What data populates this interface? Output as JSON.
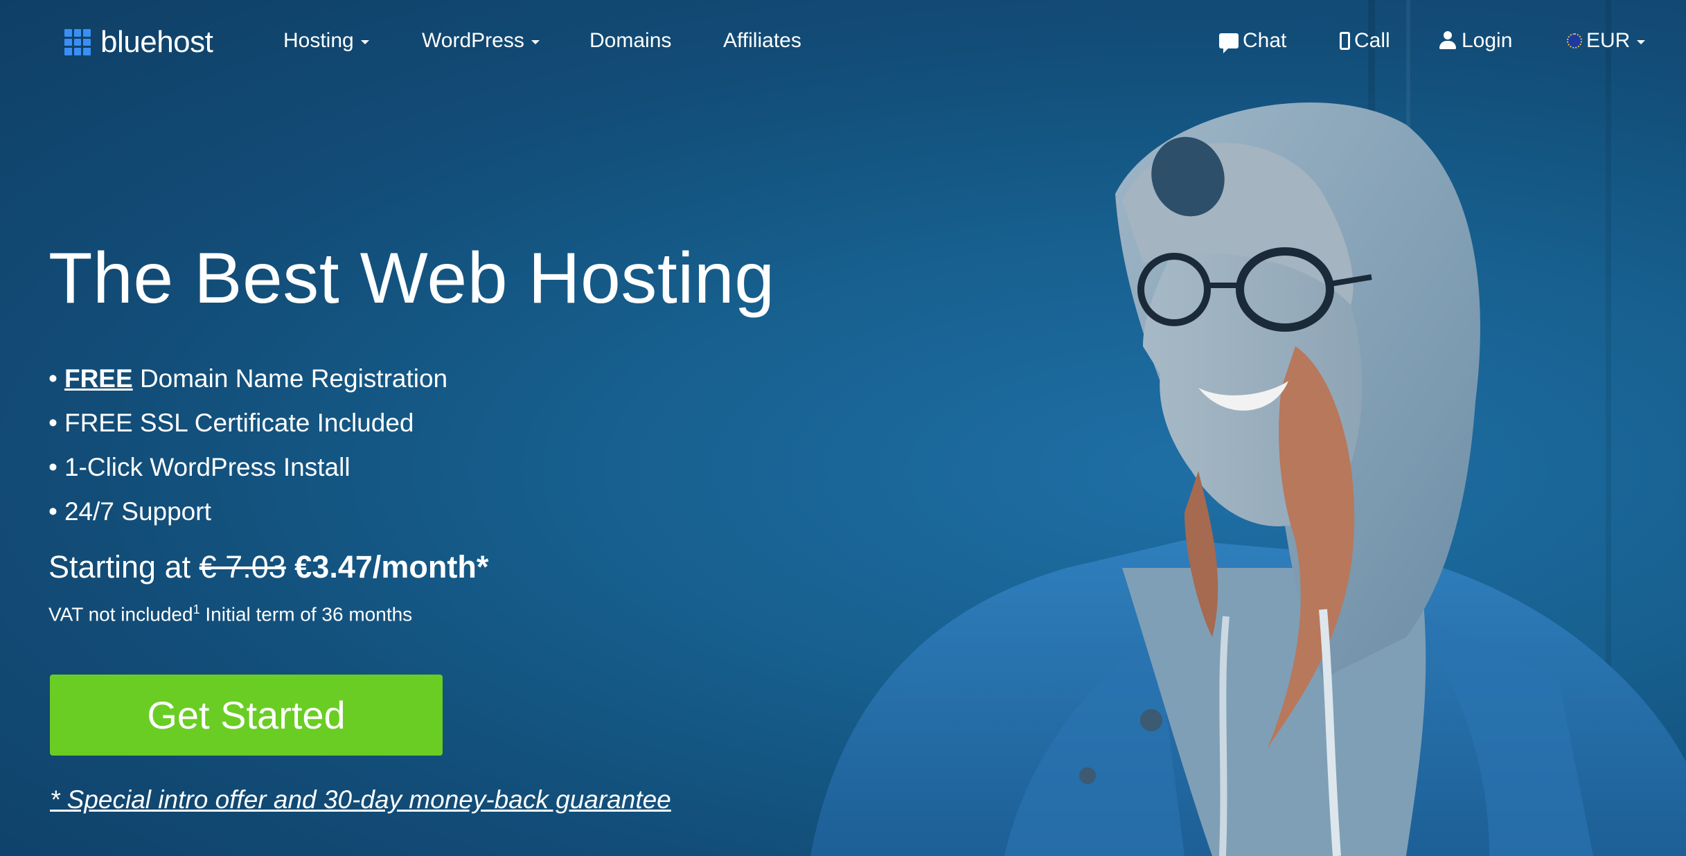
{
  "brand": {
    "name": "bluehost",
    "accent": "#3a8ff5",
    "cta_color": "#6acd24",
    "bg_color": "#124d78"
  },
  "nav": {
    "items": [
      {
        "label": "Hosting",
        "dropdown": true
      },
      {
        "label": "WordPress",
        "dropdown": true
      },
      {
        "label": "Domains",
        "dropdown": false
      },
      {
        "label": "Affiliates",
        "dropdown": false
      }
    ],
    "right": {
      "chat": {
        "label": "Chat",
        "icon": "chat-icon"
      },
      "call": {
        "label": "Call",
        "icon": "phone-icon"
      },
      "login": {
        "label": "Login",
        "icon": "user-icon"
      },
      "currency": {
        "label": "EUR",
        "icon": "eu-flag-icon"
      }
    }
  },
  "hero": {
    "title": "The Best Web Hosting",
    "bullets": {
      "b1_strong": "FREE",
      "b1_rest": "Domain Name Registration",
      "b2": "FREE SSL Certificate Included",
      "b3": "1-Click WordPress Install",
      "b4": "24/7 Support"
    },
    "bullet_char": "•",
    "price_prefix": "Starting at",
    "price_old": "€ 7.03",
    "price_new": "€3.47/month*",
    "vat_text": "VAT not included",
    "vat_sup": "1",
    "term_text": "Initial term of 36 months",
    "cta_label": "Get Started",
    "fine_print": "* Special intro offer and 30-day money-back guarantee"
  }
}
